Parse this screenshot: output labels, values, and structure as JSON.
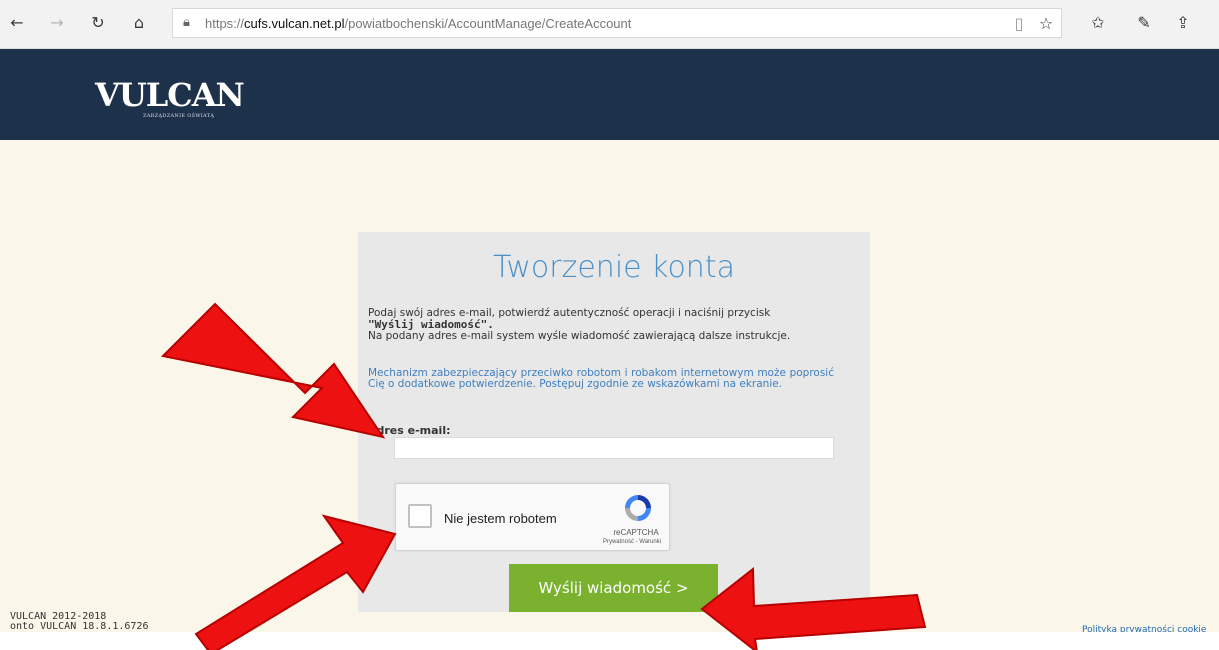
{
  "browser": {
    "url_prefix": "https://",
    "url_host": "cufs.vulcan.net.pl",
    "url_path": "/powiatbochenski/AccountManage/CreateAccount",
    "icons": [
      "back-arrow-icon",
      "forward-arrow-icon",
      "refresh-icon",
      "home-icon",
      "lock-icon",
      "reading-view-icon",
      "favorite-star-icon",
      "favorites-list-icon",
      "pen-icon",
      "share-icon"
    ]
  },
  "header": {
    "logo": "VULCAN",
    "logo_sub": "ZARZĄDZANIE OŚWIATĄ",
    "background": "#1e314a"
  },
  "form": {
    "title": "Tworzenie konta",
    "intro_line1": "Podaj swój adres e-mail, potwierdź autentyczność operacji i naciśnij przycisk",
    "intro_bold": "\"Wyślij wiadomość\".",
    "intro_line2": "Na podany adres e-mail system wyśle wiadomość zawierającą dalsze instrukcje.",
    "security_note": "Mechanizm zabezpieczający przeciwko robotom i robakom internetowym może poprosić Cię o dodatkowe potwierdzenie. Postępuj zgodnie ze wskazówkami na ekranie.",
    "email_label": "Adres e-mail:",
    "email_value": "",
    "captcha_label": "Nie jestem robotem",
    "captcha_brand": "reCAPTCHA",
    "captcha_links": "Prywatność - Warunki",
    "submit_label": "Wyślij wiadomość >"
  },
  "footer": {
    "copyright": "VULCAN 2012-2018",
    "version": "onto VULCAN 18.8.1.6726",
    "privacy_link": "Polityka prywatności cookie"
  },
  "colors": {
    "accent_title": "#4a90c8",
    "button": "#7ab230",
    "annotation_arrow": "#ee1111",
    "page_bg": "#fbf6ea"
  }
}
